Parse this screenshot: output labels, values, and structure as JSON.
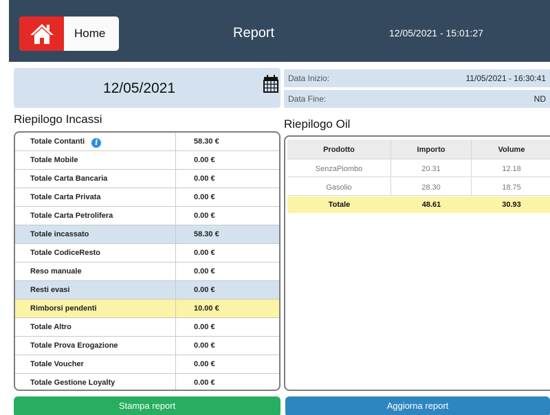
{
  "header": {
    "home_label": "Home",
    "title": "Report",
    "datetime": "12/05/2021 - 15:01:27"
  },
  "date_selector": {
    "value": "12/05/2021"
  },
  "range": {
    "start_label": "Data Inizio:",
    "start_value": "11/05/2021 - 16:30:41",
    "end_label": "Data Fine:",
    "end_value": "ND"
  },
  "incassi": {
    "title": "Riepilogo Incassi",
    "rows": [
      {
        "label": "Totale Contanti",
        "value": "58.30 €"
      },
      {
        "label": "Totale Mobile",
        "value": "0.00 €"
      },
      {
        "label": "Totale Carta Bancaria",
        "value": "0.00 €"
      },
      {
        "label": "Totale Carta Privata",
        "value": "0.00 €"
      },
      {
        "label": "Totale Carta Petrolifera",
        "value": "0.00 €"
      },
      {
        "label": "Totale incassato",
        "value": "58.30 €"
      },
      {
        "label": "Totale CodiceResto",
        "value": "0.00 €"
      },
      {
        "label": "Reso manuale",
        "value": "0.00 €"
      },
      {
        "label": "Resti evasi",
        "value": "0.00 €"
      },
      {
        "label": "Rimborsi pendenti",
        "value": "10.00 €"
      },
      {
        "label": "Totale Altro",
        "value": "0.00 €"
      },
      {
        "label": "Totale Prova Erogazione",
        "value": "0.00 €"
      },
      {
        "label": "Totale Voucher",
        "value": "0.00 €"
      },
      {
        "label": "Totale Gestione Loyalty",
        "value": "0.00 €"
      }
    ]
  },
  "oil": {
    "title": "Riepilogo Oil",
    "columns": [
      "Prodotto",
      "Importo",
      "Volume"
    ],
    "rows": [
      [
        "SenzaPiombo",
        "20.31",
        "12.18"
      ],
      [
        "Gasolio",
        "28.30",
        "18.75"
      ]
    ],
    "total": [
      "Totale",
      "48.61",
      "30.93"
    ]
  },
  "buttons": {
    "print": "Stampa report",
    "refresh": "Aggiorna report"
  },
  "colors": {
    "header_bg": "#34495e",
    "home_red": "#e52a25",
    "highlight_blue": "#d3e2ee",
    "highlight_yellow": "#fbf3a6",
    "print_green": "#27ae60",
    "refresh_blue": "#2e86c1"
  },
  "icons": {
    "home": "home-icon",
    "calendar": "calendar-icon",
    "info": "info-icon"
  }
}
